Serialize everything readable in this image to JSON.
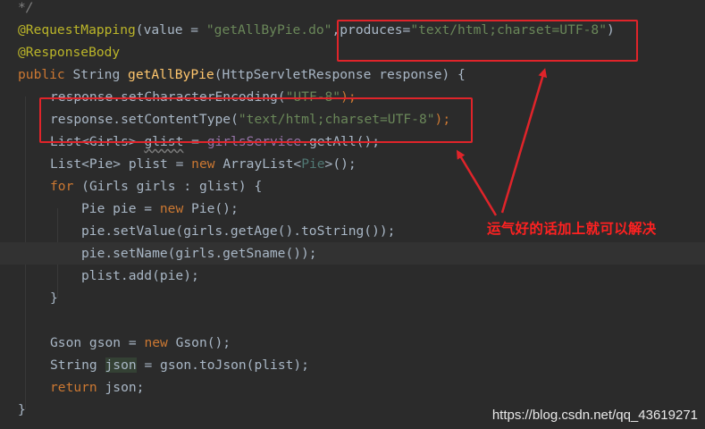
{
  "editor": {
    "lines": [
      {
        "indent": 20,
        "hl": false,
        "tokens": [
          {
            "t": "*/",
            "c": "comment"
          }
        ]
      },
      {
        "indent": 20,
        "hl": false,
        "tokens": [
          {
            "t": "@RequestMapping",
            "c": "ann"
          },
          {
            "t": "(value = ",
            "c": "plain"
          },
          {
            "t": "\"getAllByPie.do\"",
            "c": "str"
          },
          {
            "t": ",produces=",
            "c": "plain"
          },
          {
            "t": "\"text/html;charset=UTF-8\"",
            "c": "str"
          },
          {
            "t": ")",
            "c": "plain"
          }
        ]
      },
      {
        "indent": 20,
        "hl": false,
        "tokens": [
          {
            "t": "@ResponseBody",
            "c": "ann"
          }
        ]
      },
      {
        "indent": 20,
        "hl": false,
        "tokens": [
          {
            "t": "public ",
            "c": "kw"
          },
          {
            "t": "String ",
            "c": "plain"
          },
          {
            "t": "getAllByPie",
            "c": "fn"
          },
          {
            "t": "(HttpServletResponse response) {",
            "c": "plain"
          }
        ]
      },
      {
        "indent": 56,
        "hl": false,
        "tokens": [
          {
            "t": "response.setCharacterEncoding(",
            "c": "plain"
          },
          {
            "t": "\"UTF-8\"",
            "c": "str"
          },
          {
            "t": ");",
            "c": "kw"
          }
        ]
      },
      {
        "indent": 56,
        "hl": false,
        "tokens": [
          {
            "t": "response.setContentType(",
            "c": "plain"
          },
          {
            "t": "\"text/html;charset=UTF-8\"",
            "c": "str"
          },
          {
            "t": ");",
            "c": "kw"
          }
        ]
      },
      {
        "indent": 56,
        "hl": false,
        "tokens": [
          {
            "t": "List<Girls> ",
            "c": "plain"
          },
          {
            "t": "glist",
            "c": "under"
          },
          {
            "t": " = ",
            "c": "plain"
          },
          {
            "t": "girlsService",
            "c": "field"
          },
          {
            "t": ".getAll();",
            "c": "plain"
          }
        ]
      },
      {
        "indent": 56,
        "hl": false,
        "tokens": [
          {
            "t": "List<Pie> plist = ",
            "c": "plain"
          },
          {
            "t": "new ",
            "c": "kw"
          },
          {
            "t": "ArrayList<",
            "c": "plain"
          },
          {
            "t": "Pie",
            "c": "typearg"
          },
          {
            "t": ">();",
            "c": "plain"
          }
        ]
      },
      {
        "indent": 56,
        "hl": false,
        "tokens": [
          {
            "t": "for ",
            "c": "kw"
          },
          {
            "t": "(Girls girls : glist) {",
            "c": "plain"
          }
        ]
      },
      {
        "indent": 91,
        "hl": false,
        "tokens": [
          {
            "t": "Pie pie = ",
            "c": "plain"
          },
          {
            "t": "new ",
            "c": "kw"
          },
          {
            "t": "Pie();",
            "c": "plain"
          }
        ]
      },
      {
        "indent": 91,
        "hl": false,
        "tokens": [
          {
            "t": "pie.setValue(girls.getAge().toString());",
            "c": "plain"
          }
        ]
      },
      {
        "indent": 91,
        "hl": true,
        "tokens": [
          {
            "t": "pie.setName(girls.getSname());",
            "c": "plain"
          }
        ]
      },
      {
        "indent": 91,
        "hl": false,
        "tokens": [
          {
            "t": "plist.add(pie);",
            "c": "plain"
          }
        ]
      },
      {
        "indent": 56,
        "hl": false,
        "tokens": [
          {
            "t": "}",
            "c": "plain"
          }
        ]
      },
      {
        "indent": 56,
        "hl": false,
        "tokens": []
      },
      {
        "indent": 56,
        "hl": false,
        "tokens": [
          {
            "t": "Gson gson = ",
            "c": "plain"
          },
          {
            "t": "new ",
            "c": "kw"
          },
          {
            "t": "Gson();",
            "c": "plain"
          }
        ]
      },
      {
        "indent": 56,
        "hl": false,
        "tokens": [
          {
            "t": "String ",
            "c": "plain"
          },
          {
            "t": "json",
            "c": "json"
          },
          {
            "t": " = gson.toJson(plist);",
            "c": "plain"
          }
        ]
      },
      {
        "indent": 56,
        "hl": false,
        "tokens": [
          {
            "t": "return ",
            "c": "kw"
          },
          {
            "t": "json;",
            "c": "plain"
          }
        ]
      },
      {
        "indent": 20,
        "hl": false,
        "tokens": [
          {
            "t": "}",
            "c": "plain"
          }
        ]
      }
    ]
  },
  "annotation": {
    "text": "运气好的话加上就可以解决",
    "color": "#ff2121"
  },
  "watermark": "https://blog.csdn.net/qq_43619271",
  "colors": {
    "background": "#2b2b2b",
    "keyword": "#cc7832",
    "string": "#6a8759",
    "annotation": "#bbb529",
    "method": "#ffc66d",
    "field": "#9876aa",
    "box": "#e0242a"
  }
}
